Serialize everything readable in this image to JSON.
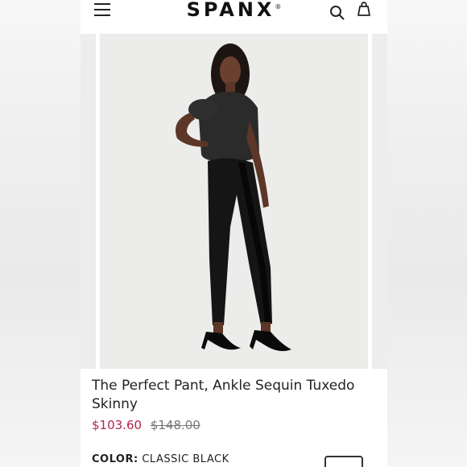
{
  "header": {
    "logo": "SPANX",
    "logo_mark": "®"
  },
  "product": {
    "title_line1": "The Perfect Pant, Ankle Sequin Tuxedo",
    "title_line2": "Skinny",
    "sale_price": "$103.60",
    "original_price": "$148.00",
    "color_label": "COLOR:",
    "color_value": "CLASSIC BLACK"
  },
  "colors": {
    "sale_price": "#b4234b",
    "background": "#ffffff",
    "photo_background": "#ececeb"
  },
  "icons": [
    "menu-icon",
    "search-icon",
    "shopping-bag-icon"
  ]
}
